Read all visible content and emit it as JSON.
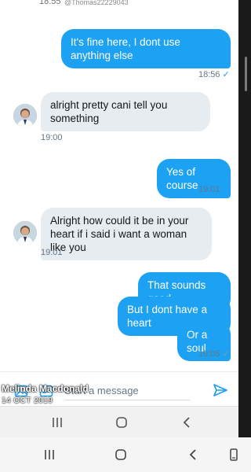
{
  "top": {
    "partial_handle": "@Thomas22229043",
    "partial_time": "18:55"
  },
  "messages": [
    {
      "dir": "out",
      "text": "It's fine here, I dont use anything else"
    },
    {
      "dir": "in",
      "text": "alright pretty cani tell you something"
    },
    {
      "dir": "out",
      "text": "Yes of course"
    },
    {
      "dir": "in",
      "text": "Alright how could it be in your heart if i said i want a woman like you"
    },
    {
      "dir": "out",
      "text": "That sounds good"
    },
    {
      "dir": "out",
      "text": "But I dont have a heart"
    },
    {
      "dir": "out",
      "text": "Or a soul"
    }
  ],
  "timestamps": {
    "t1": "18:56",
    "t2": "19:00",
    "t3": "19:01",
    "t4": "19:01",
    "t5": "19:05"
  },
  "checkmark": "✓",
  "composer": {
    "placeholder": "Start a message"
  },
  "overlay": {
    "name": "Melinda Macdonald",
    "date": "14 OCT 2019"
  },
  "colors": {
    "accent": "#1da1f2",
    "incoming_bubble": "#e6ecf0"
  },
  "icons": [
    "image-icon",
    "gif-icon",
    "send-icon",
    "recents-icon",
    "home-icon",
    "back-icon",
    "screenshot-icon"
  ]
}
